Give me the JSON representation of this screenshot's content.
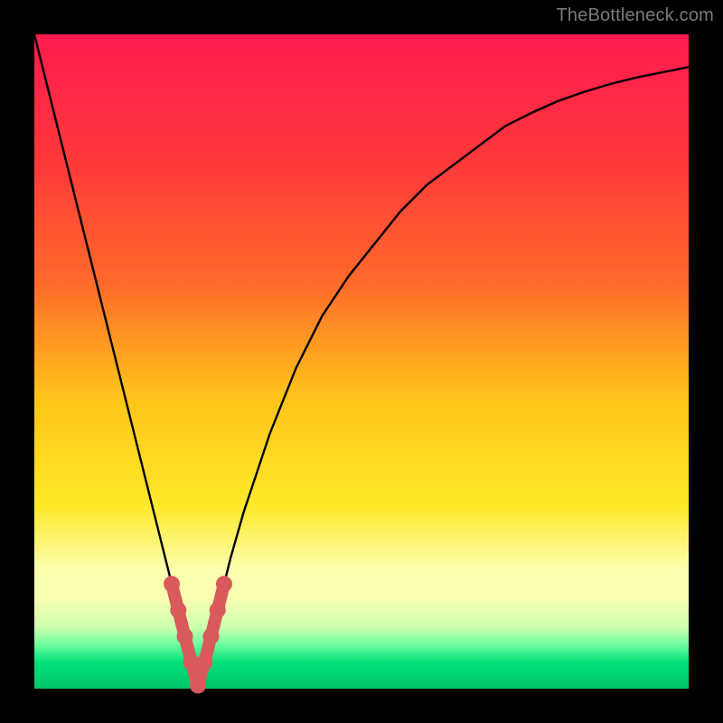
{
  "watermark": "TheBottleneck.com",
  "colors": {
    "background": "#000000",
    "gradient_top": "#ff1a4f",
    "gradient_upper_mid": "#ff6a2a",
    "gradient_mid": "#ffc21a",
    "gradient_lower_mid": "#ffe92a",
    "gradient_pale_band": "#faffb0",
    "gradient_green_light": "#7affa0",
    "gradient_green": "#00e07a",
    "gradient_green_deep": "#00c36a",
    "curve_stroke": "#000000",
    "marker_stroke": "#d85a5a",
    "marker_fill": "#d85a5a"
  },
  "chart_data": {
    "type": "line",
    "title": "",
    "xlabel": "",
    "ylabel": "",
    "xlim": [
      0,
      100
    ],
    "ylim": [
      0,
      100
    ],
    "notch_x": 25,
    "series": [
      {
        "name": "bottleneck-curve",
        "x": [
          0,
          2,
          4,
          6,
          8,
          10,
          12,
          14,
          16,
          18,
          20,
          21,
          22,
          23,
          24,
          25,
          26,
          27,
          28,
          29,
          30,
          32,
          34,
          36,
          38,
          40,
          44,
          48,
          52,
          56,
          60,
          64,
          68,
          72,
          76,
          80,
          84,
          88,
          92,
          96,
          100
        ],
        "y": [
          100,
          92,
          84,
          76,
          68,
          60,
          52,
          44,
          36,
          28,
          20,
          16,
          12,
          8,
          4,
          0.5,
          4,
          8,
          12,
          16,
          20,
          27,
          33,
          39,
          44,
          49,
          57,
          63,
          68,
          73,
          77,
          80,
          83,
          86,
          88,
          89.8,
          91.2,
          92.4,
          93.4,
          94.2,
          95
        ]
      }
    ],
    "markers": {
      "name": "highlighted-points",
      "x": [
        21,
        22,
        23,
        24,
        25,
        26,
        27,
        28,
        29
      ],
      "y": [
        16,
        12,
        8,
        4,
        0.5,
        4,
        8,
        12,
        16
      ]
    }
  }
}
